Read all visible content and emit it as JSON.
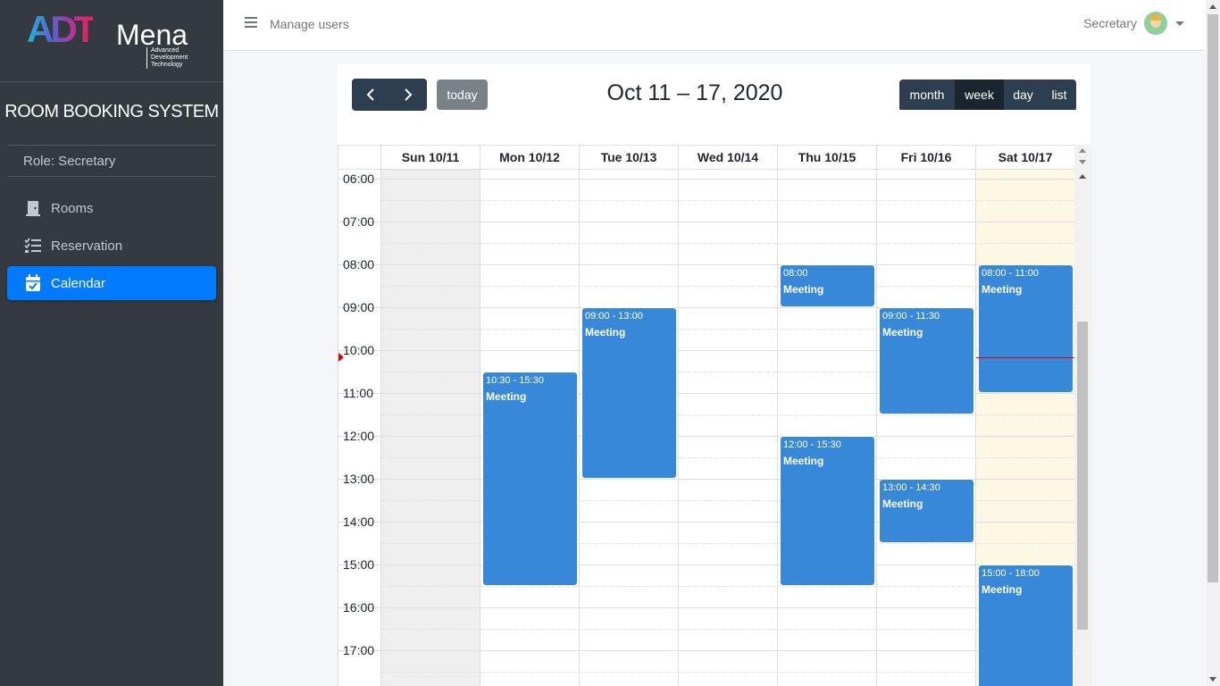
{
  "sidebar": {
    "logo": {
      "main": "ADT",
      "word": "Mena",
      "tagline": "Advanced Development Technology"
    },
    "system_title": "ROOM BOOKING SYSTEM",
    "role_text": "Role: Secretary",
    "items": [
      {
        "label": "Rooms",
        "icon": "door-icon",
        "active": false
      },
      {
        "label": "Reservation",
        "icon": "tasks-list-icon",
        "active": false
      },
      {
        "label": "Calendar",
        "icon": "calendar-check-icon",
        "active": true
      }
    ]
  },
  "header": {
    "menu_icon": "hamburger-icon",
    "title": "Manage users",
    "user_name": "Secretary"
  },
  "calendar": {
    "range_title": "Oct 11 – 17, 2020",
    "today_label": "today",
    "views": [
      "month",
      "week",
      "day",
      "list"
    ],
    "active_view": "week",
    "days": [
      "Sun 10/11",
      "Mon 10/12",
      "Tue 10/13",
      "Wed 10/14",
      "Thu 10/15",
      "Fri 10/16",
      "Sat 10/17"
    ],
    "times": [
      "06:00",
      "07:00",
      "08:00",
      "09:00",
      "10:00",
      "11:00",
      "12:00",
      "13:00",
      "14:00",
      "15:00",
      "16:00",
      "17:00"
    ],
    "events": [
      {
        "day": 4,
        "start": "08:00",
        "end": "09:00",
        "time_label": "08:00",
        "title": "Meeting"
      },
      {
        "day": 2,
        "start": "09:00",
        "end": "13:00",
        "time_label": "09:00 - 13:00",
        "title": "Meeting"
      },
      {
        "day": 5,
        "start": "09:00",
        "end": "11:30",
        "time_label": "09:00 - 11:30",
        "title": "Meeting"
      },
      {
        "day": 6,
        "start": "08:00",
        "end": "11:00",
        "time_label": "08:00 - 11:00",
        "title": "Meeting"
      },
      {
        "day": 1,
        "start": "10:30",
        "end": "15:30",
        "time_label": "10:30 - 15:30",
        "title": "Meeting"
      },
      {
        "day": 4,
        "start": "12:00",
        "end": "15:30",
        "time_label": "12:00 - 15:30",
        "title": "Meeting"
      },
      {
        "day": 5,
        "start": "13:00",
        "end": "14:30",
        "time_label": "13:00 - 14:30",
        "title": "Meeting"
      },
      {
        "day": 6,
        "start": "15:00",
        "end": "18:00",
        "time_label": "15:00 - 18:00",
        "title": "Meeting"
      }
    ],
    "now_time": "10:10",
    "colors": {
      "event": "#3788d8",
      "today_bg": "#fcf8e3",
      "past_bg": "#efefef",
      "button": "#2c3e50",
      "button_active": "#1a252f",
      "now_indicator": "#dd0000"
    }
  }
}
